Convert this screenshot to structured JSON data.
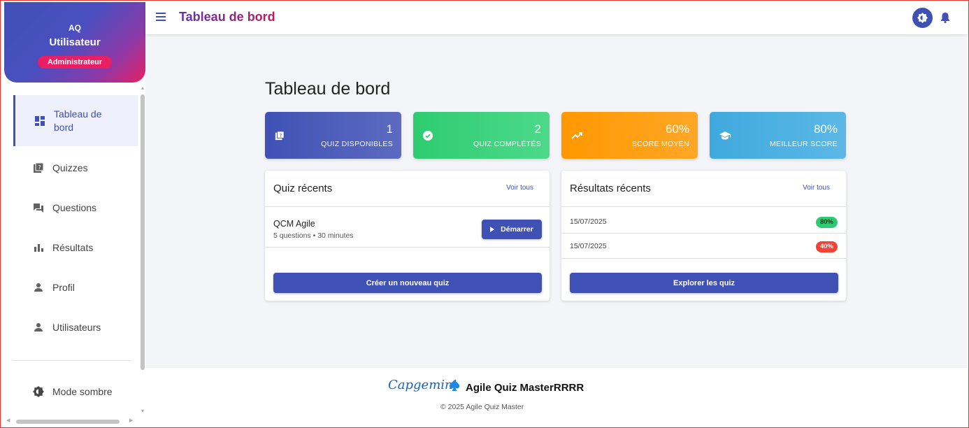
{
  "app": {
    "title": "Tableau de bord"
  },
  "profile": {
    "initials": "AQ",
    "name": "Utilisateur",
    "role": "Administrateur"
  },
  "sidebar": {
    "items": [
      {
        "label": "Tableau de bord",
        "icon": "dashboard-icon",
        "active": true
      },
      {
        "label": "Quizzes",
        "icon": "quiz-icon"
      },
      {
        "label": "Questions",
        "icon": "forum-icon"
      },
      {
        "label": "Résultats",
        "icon": "bar-chart-icon"
      },
      {
        "label": "Profil",
        "icon": "person-icon"
      },
      {
        "label": "Utilisateurs",
        "icon": "person-icon"
      }
    ],
    "dark_mode_label": "Mode sombre"
  },
  "main": {
    "title": "Tableau de bord",
    "stats": [
      {
        "value": "1",
        "label": "QUIZ DISPONIBLES",
        "icon": "quiz-icon",
        "color": "#3f51b5"
      },
      {
        "value": "2",
        "label": "QUIZ COMPLÉTÉS",
        "icon": "check-circle-icon",
        "color": "#2ecc71"
      },
      {
        "value": "60%",
        "label": "SCORE MOYEN",
        "icon": "trending-up-icon",
        "color": "#ff9800"
      },
      {
        "value": "80%",
        "label": "MEILLEUR SCORE",
        "icon": "school-icon",
        "color": "#3fa9dd"
      }
    ],
    "recent_quizzes": {
      "title": "Quiz récents",
      "see_all": "Voir tous",
      "items": [
        {
          "name": "QCM Agile",
          "meta": "5 questions • 30 minutes",
          "action": "Démarrer"
        }
      ],
      "create_label": "Créer un nouveau quiz"
    },
    "recent_results": {
      "title": "Résultats récents",
      "see_all": "Voir tous",
      "items": [
        {
          "date": "15/07/2025",
          "score": "80%",
          "status": "pass"
        },
        {
          "date": "15/07/2025",
          "score": "40%",
          "status": "fail"
        }
      ],
      "explore_label": "Explorer les quiz"
    }
  },
  "footer": {
    "logo_text": "Capgemini",
    "brand": "Agile Quiz MasterRRRR",
    "copyright": "© 2025 Agile Quiz Master"
  },
  "colors": {
    "primary": "#3f51b5",
    "accent": "#e91e63"
  }
}
